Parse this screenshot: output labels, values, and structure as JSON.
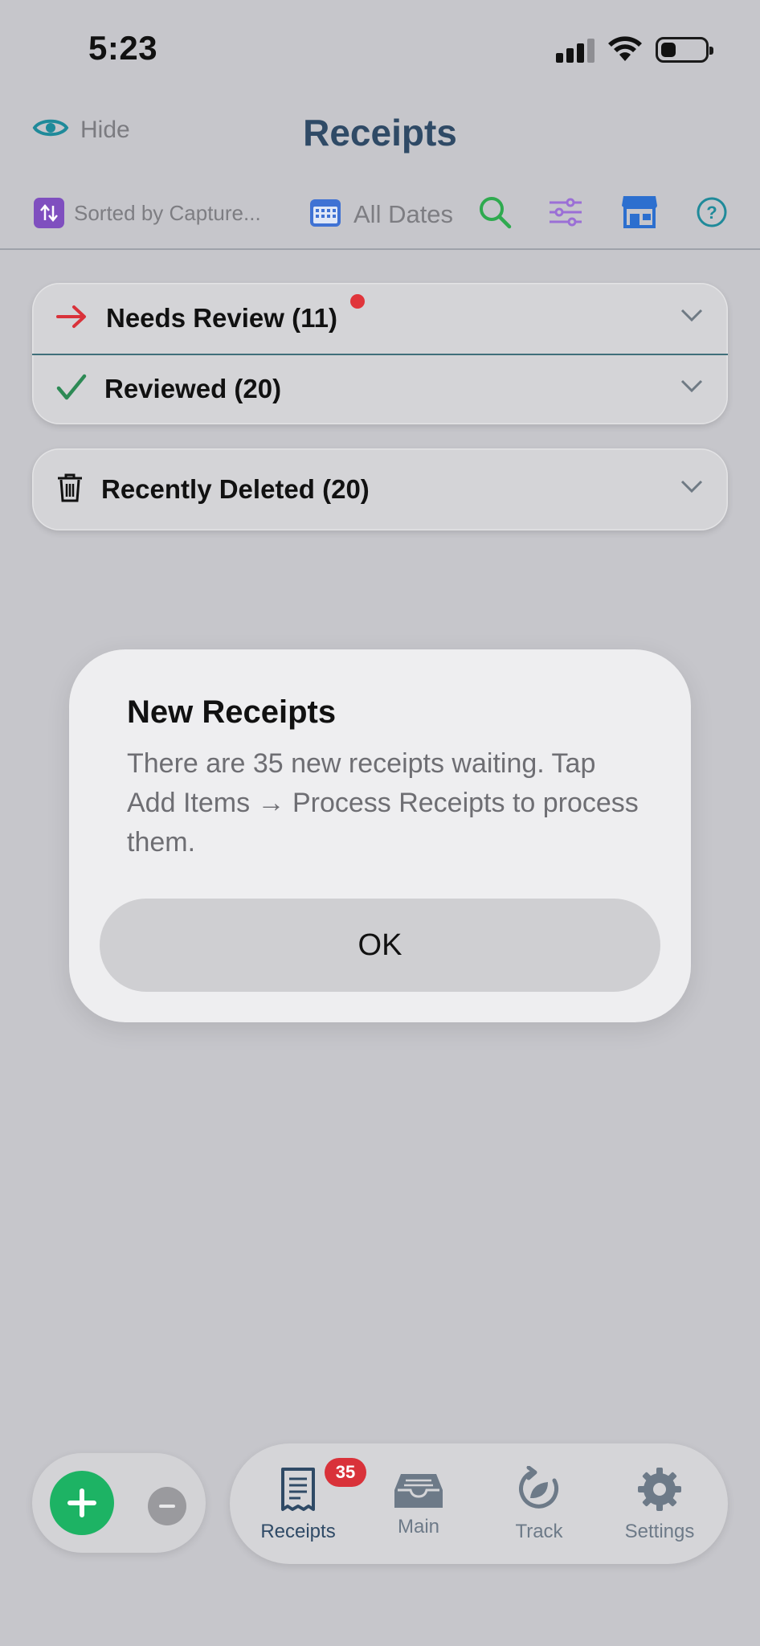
{
  "status_bar": {
    "time": "5:23"
  },
  "header": {
    "hide_label": "Hide",
    "title": "Receipts"
  },
  "toolbar": {
    "sort_label": "Sorted by Capture...",
    "dates_label": "All Dates"
  },
  "sections": {
    "needs_review": "Needs Review (11)",
    "reviewed": "Reviewed (20)",
    "recently_deleted": "Recently Deleted (20)"
  },
  "alert": {
    "title": "New Receipts",
    "message": "There are 35 new receipts waiting. Tap Add Items → Process Receipts to process them.",
    "ok_label": "OK"
  },
  "tabbar": {
    "receipts_label": "Receipts",
    "receipts_badge": "35",
    "main_label": "Main",
    "track_label": "Track",
    "settings_label": "Settings"
  },
  "colors": {
    "accent_blue": "#2f4a66",
    "needs_review_arrow": "#d9323a",
    "reviewed_check": "#2d8a55",
    "add_button": "#1db364",
    "badge": "#d9323a"
  }
}
